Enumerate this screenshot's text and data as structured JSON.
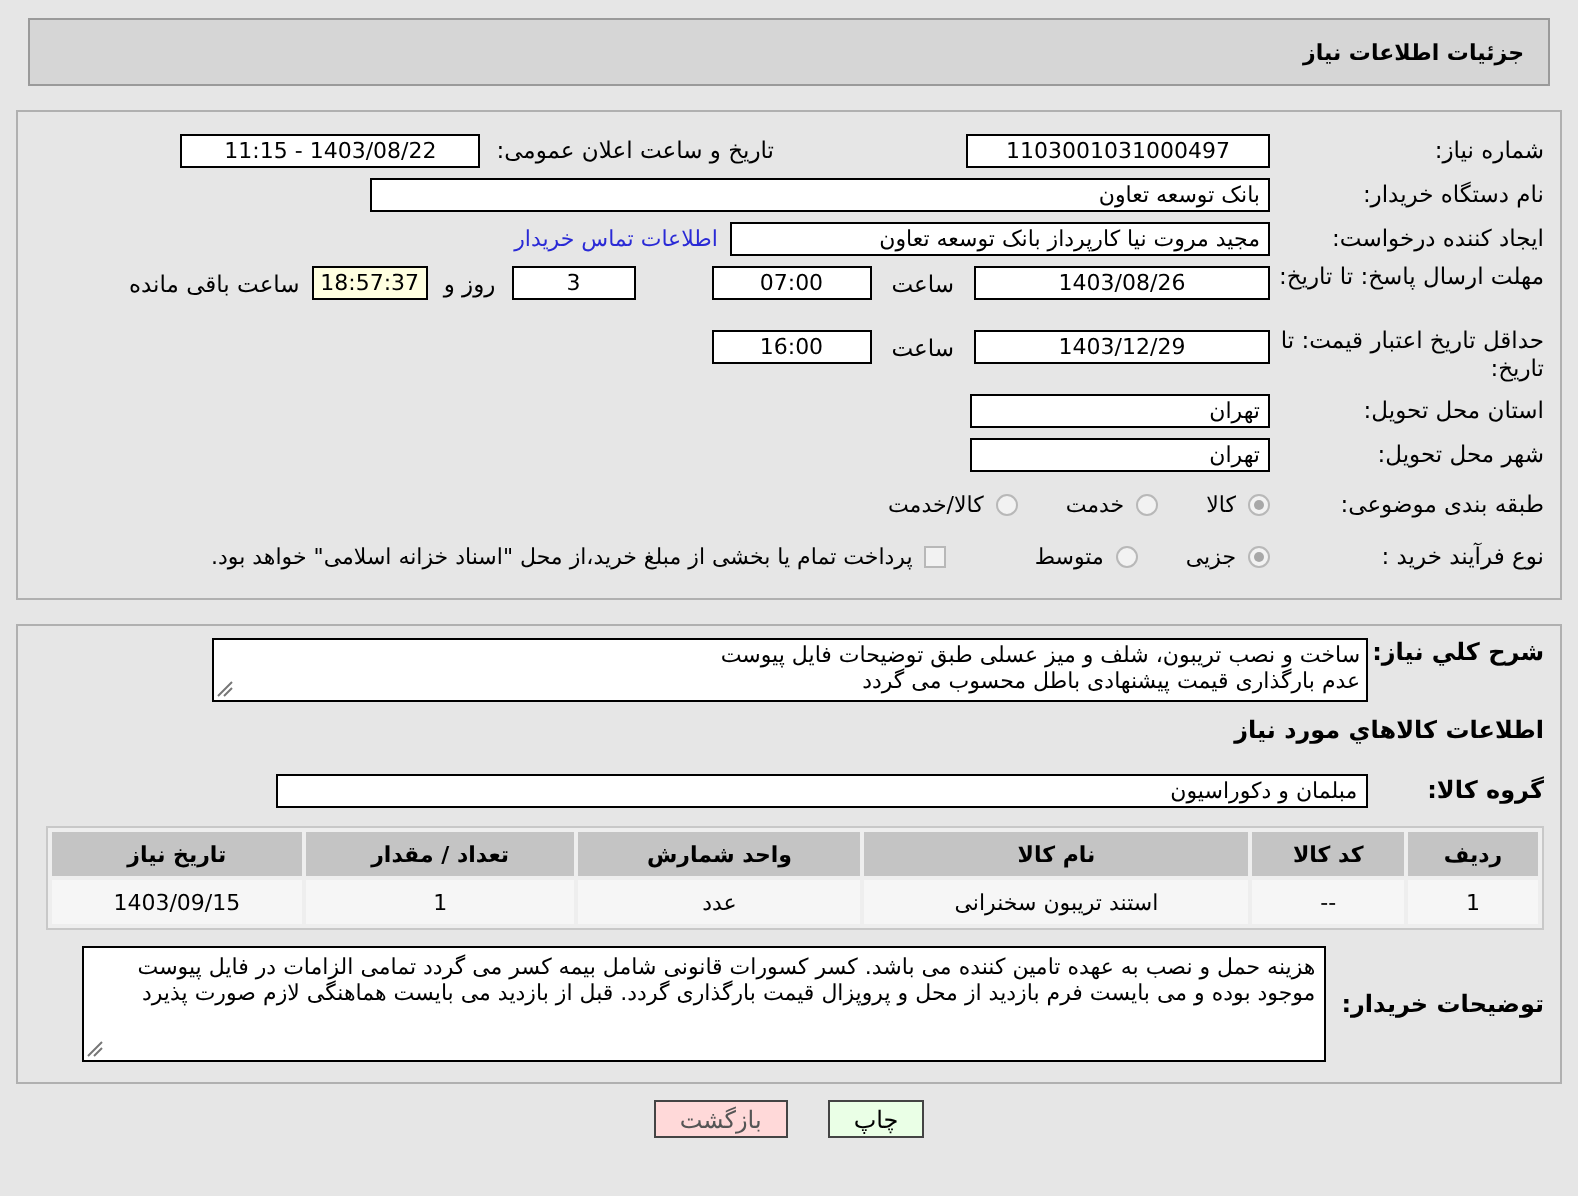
{
  "title": "جزئیات اطلاعات نیاز",
  "need_number": {
    "label": "شماره نیاز:",
    "value": "1103001031000497"
  },
  "announce": {
    "label": "تاریخ و ساعت اعلان عمومی:",
    "value": "1403/08/22 - 11:15"
  },
  "buyer": {
    "label": "نام دستگاه خریدار:",
    "value": "بانک توسعه تعاون"
  },
  "requester": {
    "label": "ایجاد کننده درخواست:",
    "value": "مجید مروت نیا کارپرداز بانک توسعه تعاون",
    "link": "اطلاعات تماس خریدار"
  },
  "reply_deadline": {
    "label": "مهلت ارسال پاسخ: تا تاریخ:",
    "date": "1403/08/26",
    "time_label": "ساعت",
    "time": "07:00",
    "days": "3",
    "days_label": "روز و",
    "remaining": "18:57:37",
    "remaining_label": "ساعت باقی مانده"
  },
  "price_validity": {
    "label": "حداقل تاریخ اعتبار قیمت: تا تاریخ:",
    "date": "1403/12/29",
    "time_label": "ساعت",
    "time": "16:00"
  },
  "province": {
    "label": "استان محل تحویل:",
    "value": "تهران"
  },
  "city": {
    "label": "شهر محل تحویل:",
    "value": "تهران"
  },
  "category": {
    "label": "طبقه بندی موضوعی:",
    "options": [
      {
        "label": "کالا",
        "selected": true
      },
      {
        "label": "خدمت",
        "selected": false
      },
      {
        "label": "کالا/خدمت",
        "selected": false
      }
    ]
  },
  "purchase_type": {
    "label": "نوع فرآیند خرید :",
    "options": [
      {
        "label": "جزیی",
        "selected": true
      },
      {
        "label": "متوسط",
        "selected": false
      }
    ],
    "treasury": {
      "checked": false,
      "text": "پرداخت تمام یا بخشی از مبلغ خرید،از محل \"اسناد خزانه اسلامی\" خواهد بود."
    }
  },
  "description": {
    "label": "شرح کلي نياز:",
    "value": "ساخت و نصب تریبون، شلف و میز عسلی طبق توضیحات فایل پیوست\nعدم بارگذاری قیمت پیشنهادی باطل محسوب می گردد"
  },
  "goods_heading": "اطلاعات کالاهاي مورد نياز",
  "goods_group": {
    "label": "گروه کالا:",
    "value": "مبلمان و دکوراسیون"
  },
  "table": {
    "columns": [
      "ردیف",
      "کد کالا",
      "نام کالا",
      "واحد شمارش",
      "تعداد / مقدار",
      "تاریخ نیاز"
    ],
    "rows": [
      [
        "1",
        "--",
        "استند تریبون سخنرانی",
        "عدد",
        "1",
        "1403/09/15"
      ]
    ]
  },
  "buyer_notes": {
    "label": "توضیحات خریدار:",
    "value": "هزینه حمل و نصب به عهده تامین کننده می باشد. کسر کسورات قانونی شامل بیمه کسر می گردد تمامی الزامات در فایل پیوست موجود بوده و می بایست فرم بازدید از محل و پروپزال قیمت بارگذاری گردد. قبل از بازدید می بایست هماهنگی لازم صورت پذیرد"
  },
  "buttons": [
    {
      "label": "چاپ",
      "kind": "print"
    },
    {
      "label": "بازگشت",
      "kind": "back"
    }
  ]
}
